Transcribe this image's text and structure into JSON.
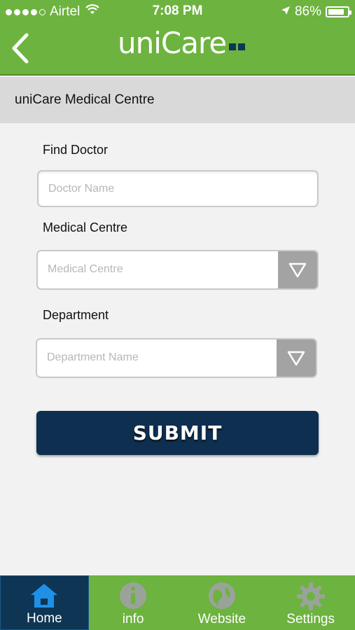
{
  "status_bar": {
    "carrier": "Airtel",
    "time": "7:08 PM",
    "battery_percent": "86%",
    "battery_level": 0.86,
    "signal_bars": 4
  },
  "header": {
    "logo_text": "uniCare",
    "back_icon": "chevron-left-icon",
    "brand_color": "#6db33f",
    "accent_color": "#0e3654"
  },
  "subheader": {
    "title": "uniCare Medical Centre"
  },
  "form": {
    "find_doctor_label": "Find Doctor",
    "doctor_placeholder": "Doctor Name",
    "medical_centre_label": "Medical Centre",
    "medical_centre_placeholder": "Medical Centre",
    "department_label": "Department",
    "department_placeholder": "Department Name",
    "submit_label": "SUBMIT"
  },
  "tabbar": {
    "tabs": [
      {
        "label": "Home",
        "icon": "home-icon",
        "active": true
      },
      {
        "label": "info",
        "icon": "info-icon",
        "active": false
      },
      {
        "label": "Website",
        "icon": "globe-icon",
        "active": false
      },
      {
        "label": "Settings",
        "icon": "gear-icon",
        "active": false
      }
    ]
  }
}
